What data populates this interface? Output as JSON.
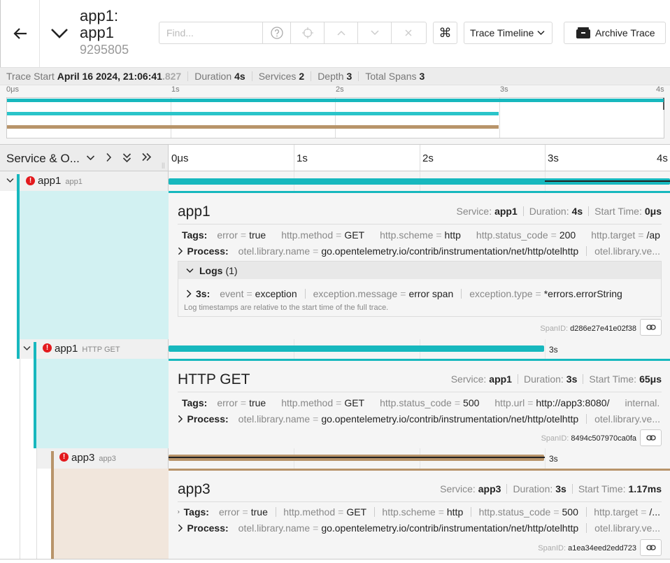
{
  "header": {
    "title": "app1: app1",
    "trace_id": "9295805",
    "find_placeholder": "Find...",
    "view_mode": "Trace Timeline",
    "archive_label": "Archive Trace",
    "cmd_glyph": "⌘"
  },
  "summary": {
    "start_label": "Trace Start",
    "start_value": "April 16 2024, 21:06:41",
    "start_ms": ".827",
    "duration_label": "Duration",
    "duration_value": "4s",
    "services_label": "Services",
    "services_value": "2",
    "depth_label": "Depth",
    "depth_value": "3",
    "spans_label": "Total Spans",
    "spans_value": "3"
  },
  "minimap": {
    "ticks": [
      "0μs",
      "1s",
      "2s",
      "3s",
      "4s"
    ],
    "spans": [
      {
        "start": 0,
        "end": 1.0,
        "color": "#17b8be"
      },
      {
        "start": 0,
        "end": 0.7484,
        "color": "#2ac4c9"
      },
      {
        "start": 0,
        "end": 0.7484,
        "color": "#b8946a"
      }
    ]
  },
  "timeline": {
    "column_label": "Service & O...",
    "ticks": [
      "0μs",
      "1s",
      "2s",
      "3s",
      "4s"
    ]
  },
  "spans": [
    {
      "service": "app1",
      "operation": "app1",
      "color": "#17b8be",
      "start": 0,
      "end": 1.0,
      "duration_label": "",
      "detail": {
        "title": "app1",
        "service_label": "Service:",
        "service": "app1",
        "duration_label": "Duration:",
        "duration": "4s",
        "start_label": "Start Time:",
        "start": "0μs",
        "tags_label": "Tags:",
        "tags": [
          {
            "k": "error",
            "v": "true"
          },
          {
            "k": "http.method",
            "v": "GET"
          },
          {
            "k": "http.scheme",
            "v": "http"
          },
          {
            "k": "http.status_code",
            "v": "200"
          },
          {
            "k": "http.target",
            "v": "/ap..."
          }
        ],
        "process_label": "Process:",
        "process": [
          {
            "k": "otel.library.name",
            "v": "go.opentelemetry.io/contrib/instrumentation/net/http/otelhttp"
          },
          {
            "k": "otel.library.ve...",
            "v": ""
          }
        ],
        "logs_label": "Logs",
        "logs_count": "(1)",
        "log_entry": {
          "time": "3s:",
          "fields": [
            {
              "k": "event",
              "v": "exception"
            },
            {
              "k": "exception.message",
              "v": "error span"
            },
            {
              "k": "exception.type",
              "v": "*errors.errorString"
            }
          ]
        },
        "logs_note": "Log timestamps are relative to the start time of the full trace.",
        "span_id_label": "SpanID:",
        "span_id": "d286e27e41e02f38"
      }
    },
    {
      "service": "app1",
      "operation": "HTTP GET",
      "color": "#17b8be",
      "start": 0,
      "end": 0.7484,
      "duration_label": "3s",
      "detail": {
        "title": "HTTP GET",
        "service_label": "Service:",
        "service": "app1",
        "duration_label": "Duration:",
        "duration": "3s",
        "start_label": "Start Time:",
        "start": "65μs",
        "tags_label": "Tags:",
        "tags": [
          {
            "k": "error",
            "v": "true"
          },
          {
            "k": "http.method",
            "v": "GET"
          },
          {
            "k": "http.status_code",
            "v": "500"
          },
          {
            "k": "http.url",
            "v": "http://app3:8080/"
          },
          {
            "k": "internal....",
            "v": ""
          }
        ],
        "process_label": "Process:",
        "process": [
          {
            "k": "otel.library.name",
            "v": "go.opentelemetry.io/contrib/instrumentation/net/http/otelhttp"
          },
          {
            "k": "otel.library.ve...",
            "v": ""
          }
        ],
        "span_id_label": "SpanID:",
        "span_id": "8494c507970ca0fa"
      }
    },
    {
      "service": "app3",
      "operation": "app3",
      "color": "#b8946a",
      "start": 0,
      "end": 0.7484,
      "duration_label": "3s",
      "detail": {
        "title": "app3",
        "service_label": "Service:",
        "service": "app3",
        "duration_label": "Duration:",
        "duration": "3s",
        "start_label": "Start Time:",
        "start": "1.17ms",
        "tags_label": "Tags:",
        "tags": [
          {
            "k": "error",
            "v": "true"
          },
          {
            "k": "http.method",
            "v": "GET"
          },
          {
            "k": "http.scheme",
            "v": "http"
          },
          {
            "k": "http.status_code",
            "v": "500"
          },
          {
            "k": "http.target",
            "v": "/..."
          }
        ],
        "process_label": "Process:",
        "process": [
          {
            "k": "otel.library.name",
            "v": "go.opentelemetry.io/contrib/instrumentation/net/http/otelhttp"
          },
          {
            "k": "otel.library.ve...",
            "v": ""
          }
        ],
        "span_id_label": "SpanID:",
        "span_id": "a1ea34eed2edd723"
      }
    }
  ],
  "colors": {
    "teal": "#17b8be",
    "teal_light": "#d2f1f2",
    "brown": "#b8946a",
    "brown_light": "#f1e6dc",
    "error": "#e3191d"
  }
}
